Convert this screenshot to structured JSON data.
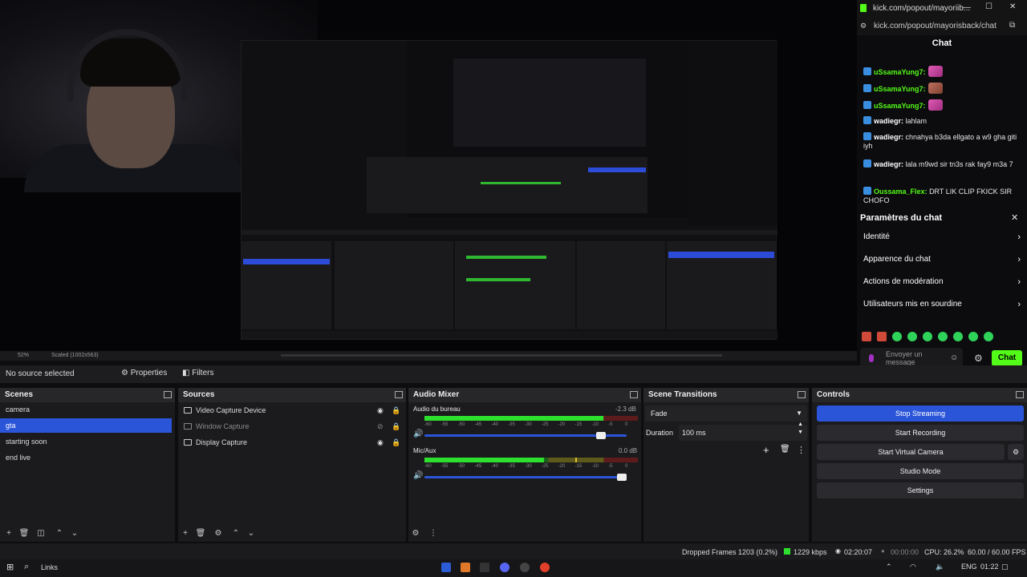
{
  "preview": {
    "zoom": "52%",
    "scaled": "Scaled (1002x563)"
  },
  "chat": {
    "window_url": "kick.com/popout/mayoriib...",
    "url": "kick.com/popout/mayorisback/chat",
    "header": "Chat",
    "messages": [
      {
        "user": "uSsamaYung7:",
        "text": ""
      },
      {
        "user": "uSsamaYung7:",
        "text": ""
      },
      {
        "user": "uSsamaYung7:",
        "text": ""
      },
      {
        "user": "wadiegr:",
        "text": "lahlam"
      },
      {
        "user": "wadiegr:",
        "text": "chnahya b3da ellgato a w9 gha giti iyh"
      },
      {
        "user": "wadiegr:",
        "text": "lala m9wd sir tn3s rak fay9 m3a 7"
      },
      {
        "user": "Oussama_Flex:",
        "text": "DRT LIK CLIP FKICK SIR CHOFO"
      }
    ],
    "settings_title": "Paramètres du chat",
    "settings_items": [
      "Identité",
      "Apparence du chat",
      "Actions de modération",
      "Utilisateurs mis en sourdine"
    ],
    "input_placeholder": "Envoyer un message",
    "send_label": "Chat"
  },
  "context_bar": {
    "no_source": "No source selected",
    "properties": "Properties",
    "filters": "Filters"
  },
  "scenes": {
    "title": "Scenes",
    "items": [
      "camera",
      "gta",
      "starting soon",
      "end live"
    ],
    "selected": "gta"
  },
  "sources": {
    "title": "Sources",
    "items": [
      "Video Capture Device",
      "Window Capture",
      "Display Capture"
    ]
  },
  "audio_mixer": {
    "title": "Audio Mixer",
    "channels": [
      {
        "name": "Audio du bureau",
        "db": "-2.3 dB",
        "level": 0.84,
        "volume": 0.89
      },
      {
        "name": "Mic/Aux",
        "db": "0.0 dB",
        "level": 0.56,
        "volume": 1.0
      }
    ],
    "ticks": [
      "-60",
      "-55",
      "-50",
      "-45",
      "-40",
      "-35",
      "-30",
      "-25",
      "-20",
      "-15",
      "-10",
      "-5",
      "0"
    ]
  },
  "transitions": {
    "title": "Scene Transitions",
    "selected": "Fade",
    "duration_label": "Duration",
    "duration_value": "100 ms"
  },
  "controls": {
    "title": "Controls",
    "buttons": [
      "Stop Streaming",
      "Start Recording",
      "Start Virtual Camera",
      "Studio Mode",
      "Settings"
    ]
  },
  "status": {
    "dropped": "Dropped Frames 1203 (0.2%)",
    "bitrate": "1229 kbps",
    "stream_time": "02:20:07",
    "rec_time": "00:00:00",
    "cpu": "CPU: 26.2%",
    "fps": "60.00 / 60.00 FPS"
  },
  "taskbar": {
    "search": "Links",
    "lang": "ENG",
    "time": "01:22"
  }
}
